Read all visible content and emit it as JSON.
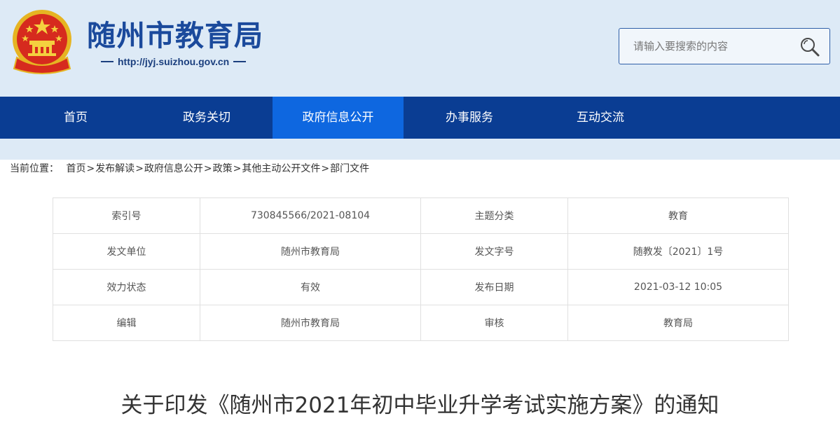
{
  "header": {
    "site_name": "随州市教育局",
    "site_url": "http://jyj.suizhou.gov.cn",
    "emblem_icon": "national-emblem-icon"
  },
  "search": {
    "placeholder": "请输入要搜索的内容",
    "value": "",
    "icon": "search-icon"
  },
  "nav": {
    "items": [
      {
        "label": "首页",
        "active": false
      },
      {
        "label": "政务关切",
        "active": false
      },
      {
        "label": "政府信息公开",
        "active": true
      },
      {
        "label": "办事服务",
        "active": false
      },
      {
        "label": "互动交流",
        "active": false
      }
    ]
  },
  "breadcrumb": {
    "prefix": "当前位置：",
    "items": [
      "首页",
      "发布解读",
      "政府信息公开",
      "政策",
      "其他主动公开文件",
      "部门文件"
    ],
    "separator": ">"
  },
  "meta": {
    "rows": [
      [
        {
          "label": "索引号",
          "value": "730845566/2021-08104"
        },
        {
          "label": "主题分类",
          "value": "教育"
        }
      ],
      [
        {
          "label": "发文单位",
          "value": "随州市教育局"
        },
        {
          "label": "发文字号",
          "value": "随教发〔2021〕1号"
        }
      ],
      [
        {
          "label": "效力状态",
          "value": "有效"
        },
        {
          "label": "发布日期",
          "value": "2021-03-12 10:05"
        }
      ],
      [
        {
          "label": "编辑",
          "value": "随州市教育局"
        },
        {
          "label": "审核",
          "value": "教育局"
        }
      ]
    ]
  },
  "document": {
    "title": "关于印发《随州市2021年初中毕业升学考试实施方案》的通知"
  },
  "colors": {
    "header_bg": "#ddeaf6",
    "nav_bg": "#0a3d93",
    "nav_active": "#0e67e0",
    "site_name": "#1b4a9c"
  }
}
